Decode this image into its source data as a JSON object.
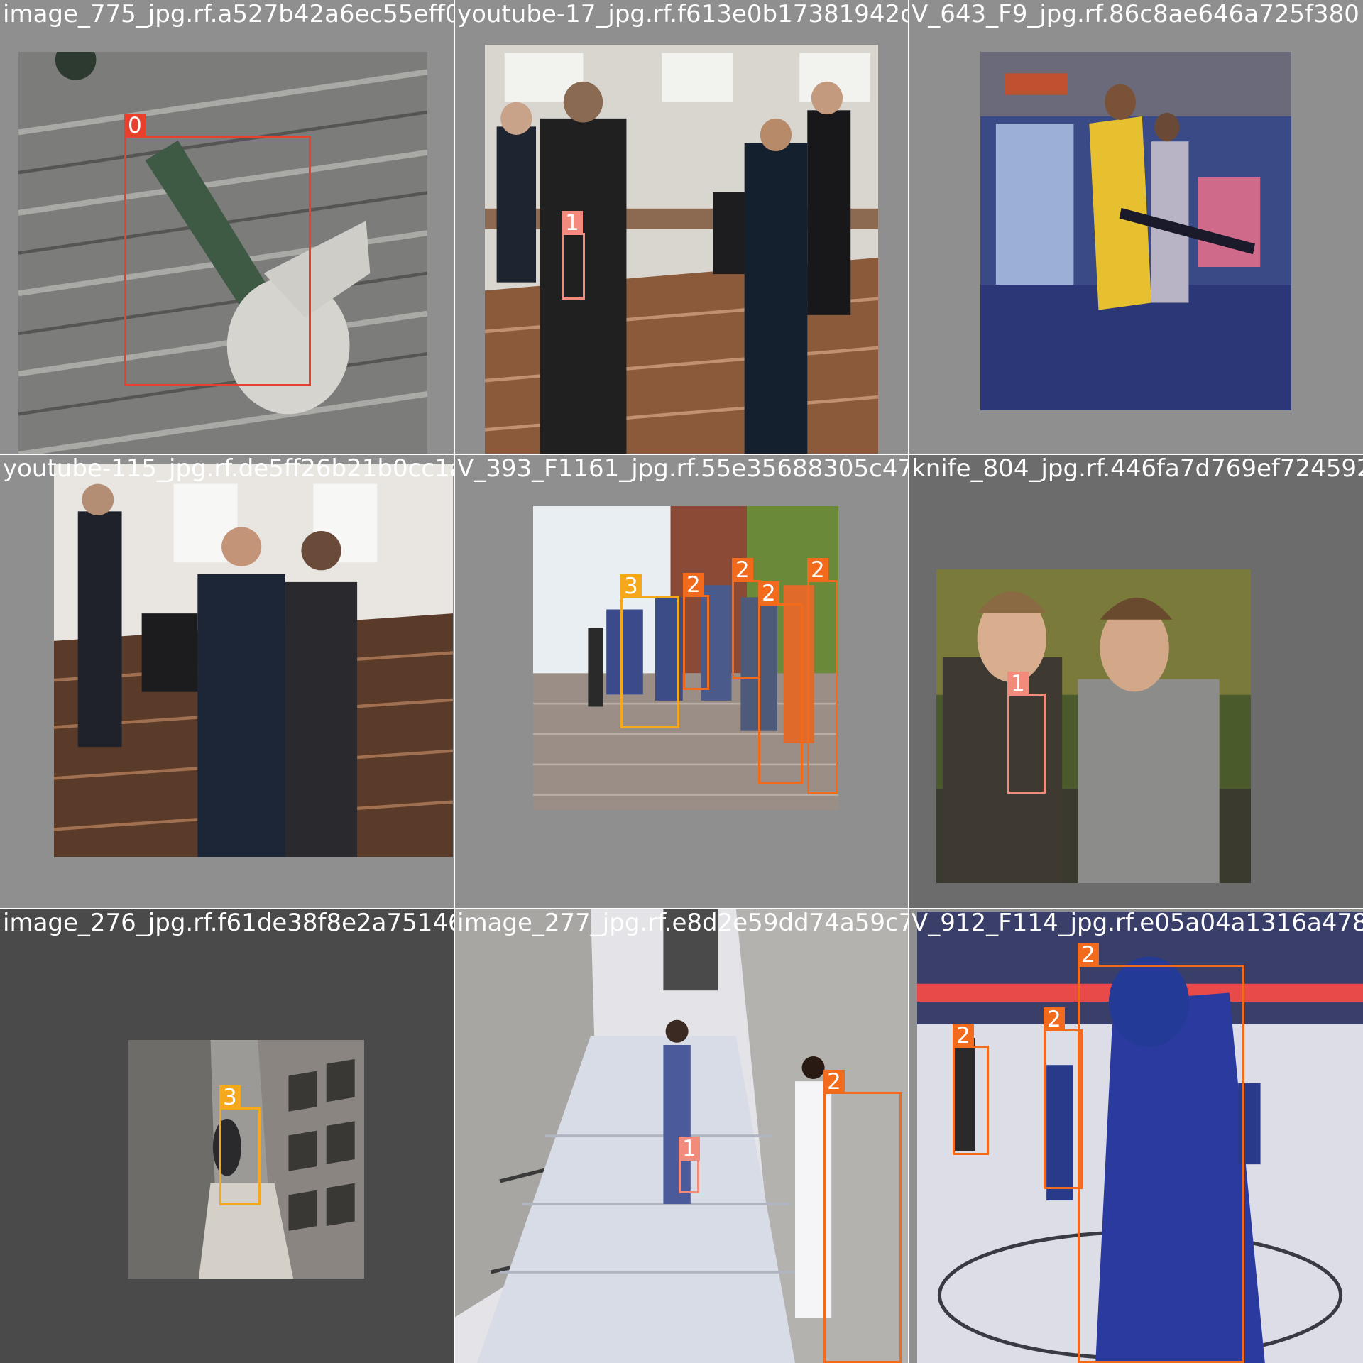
{
  "mosaic_title": "",
  "class_colors": {
    "0": "#e8402c",
    "1": "#f28b7c",
    "2": "#f26a1c",
    "3": "#f5a81c"
  },
  "tiles": [
    {
      "filename": "image_775_jpg.rf.a527b42a6ec55eff02f5e499",
      "boxes": [
        {
          "class_id": "0"
        }
      ]
    },
    {
      "filename": "youtube-17_jpg.rf.f613e0b17381942c395341",
      "boxes": [
        {
          "class_id": "1"
        }
      ]
    },
    {
      "filename": "V_643_F9_jpg.rf.86c8ae646a725f380",
      "boxes": []
    },
    {
      "filename": "youtube-115_jpg.rf.de5ff26b21b0cc1a4e7e7",
      "boxes": []
    },
    {
      "filename": "V_393_F1161_jpg.rf.55e35688305c47f1436d40",
      "boxes": [
        {
          "class_id": "3"
        },
        {
          "class_id": "2"
        },
        {
          "class_id": "2"
        },
        {
          "class_id": "2"
        },
        {
          "class_id": "2"
        }
      ]
    },
    {
      "filename": "knife_804_jpg.rf.446fa7d769ef724592",
      "boxes": [
        {
          "class_id": "1"
        }
      ]
    },
    {
      "filename": "image_276_jpg.rf.f61de38f8e2a751465f1ed",
      "boxes": [
        {
          "class_id": "3"
        }
      ]
    },
    {
      "filename": "image_277_jpg.rf.e8d2e59dd74a59c7f9f41a",
      "boxes": [
        {
          "class_id": "1"
        },
        {
          "class_id": "2"
        }
      ]
    },
    {
      "filename": "V_912_F114_jpg.rf.e05a04a1316a478",
      "boxes": [
        {
          "class_id": "2"
        },
        {
          "class_id": "2"
        },
        {
          "class_id": "2"
        }
      ]
    }
  ]
}
